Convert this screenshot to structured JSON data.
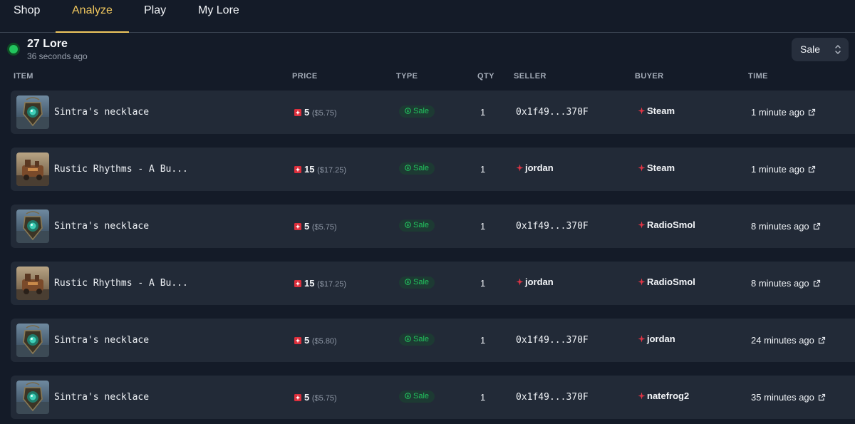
{
  "nav": {
    "tabs": [
      {
        "label": "Shop"
      },
      {
        "label": "Analyze"
      },
      {
        "label": "Play"
      },
      {
        "label": "My Lore"
      }
    ],
    "active_tab": "Analyze"
  },
  "status": {
    "count_label": "27 Lore",
    "updated_label": "36 seconds ago",
    "indicator_color": "#22c55e"
  },
  "filter": {
    "selected": "Sale"
  },
  "table": {
    "columns": [
      "ITEM",
      "PRICE",
      "TYPE",
      "QTY",
      "SELLER",
      "BUYER",
      "TIME"
    ],
    "rows": [
      {
        "item": "Sintra's necklace",
        "price": "5",
        "usd": "($5.75)",
        "type": "Sale",
        "qty": "1",
        "seller": "0x1f49...370F",
        "buyer": "Steam",
        "time": "1 minute ago"
      },
      {
        "item": "Rustic Rhythms - A Bu...",
        "price": "15",
        "usd": "($17.25)",
        "type": "Sale",
        "qty": "1",
        "seller": "jordan",
        "buyer": "Steam",
        "time": "1 minute ago"
      },
      {
        "item": "Sintra's necklace",
        "price": "5",
        "usd": "($5.75)",
        "type": "Sale",
        "qty": "1",
        "seller": "0x1f49...370F",
        "buyer": "RadioSmol",
        "time": "8 minutes ago"
      },
      {
        "item": "Rustic Rhythms - A Bu...",
        "price": "15",
        "usd": "($17.25)",
        "type": "Sale",
        "qty": "1",
        "seller": "jordan",
        "buyer": "RadioSmol",
        "time": "8 minutes ago"
      },
      {
        "item": "Sintra's necklace",
        "price": "5",
        "usd": "($5.80)",
        "type": "Sale",
        "qty": "1",
        "seller": "0x1f49...370F",
        "buyer": "jordan",
        "time": "24 minutes ago"
      },
      {
        "item": "Sintra's necklace",
        "price": "5",
        "usd": "($5.75)",
        "type": "Sale",
        "qty": "1",
        "seller": "0x1f49...370F",
        "buyer": "natefrog2",
        "time": "35 minutes ago"
      }
    ]
  },
  "colors": {
    "background": "#141b28",
    "row": "#222a37",
    "accent": "#f0c75e",
    "sale_green": "#22c55e",
    "magic_red": "#dc2f3c"
  }
}
